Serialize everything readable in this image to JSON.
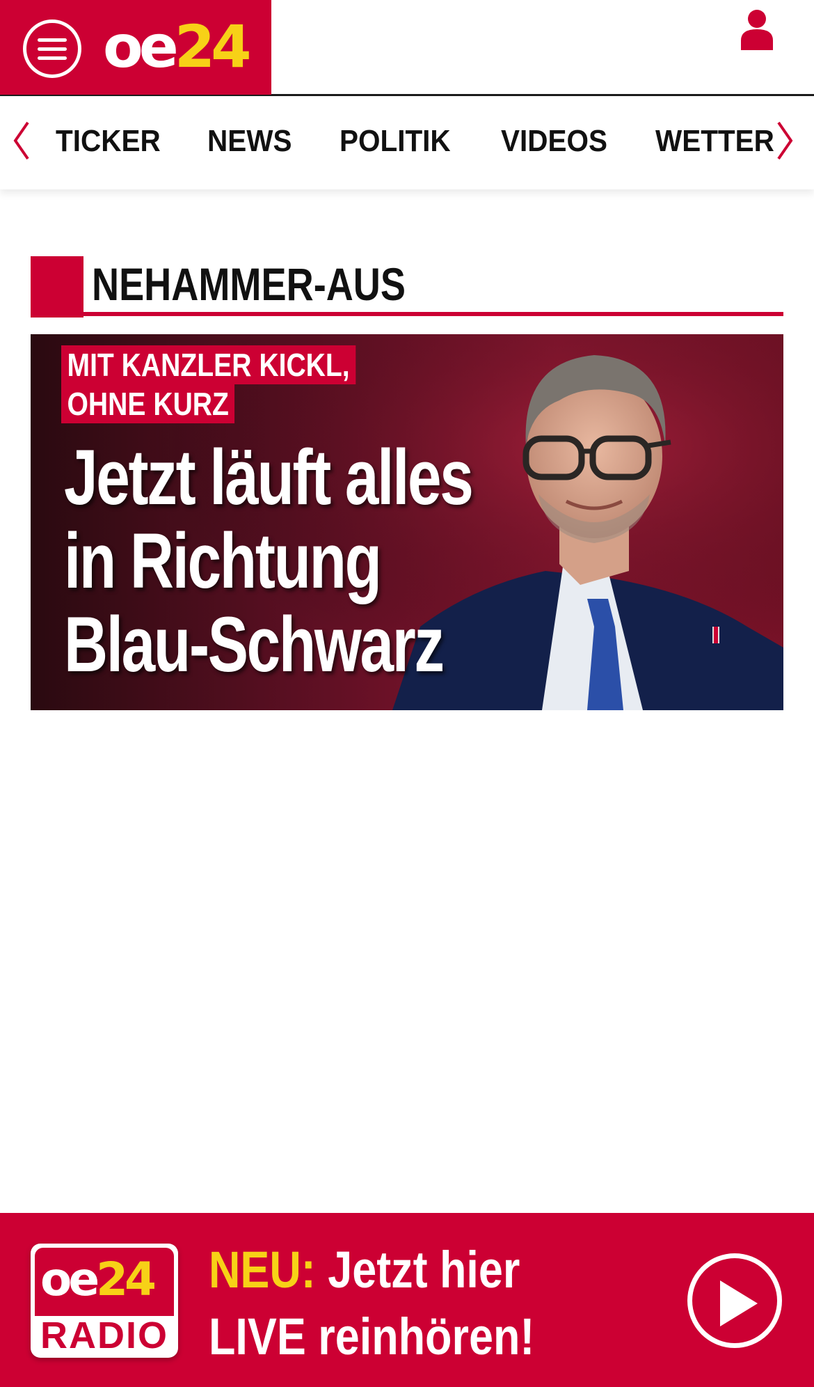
{
  "header": {
    "logo_oe": "oe",
    "logo_24": "24",
    "brand_color": "#cc0033",
    "accent_color": "#f7d117"
  },
  "nav": {
    "items": [
      {
        "label": "TICKER"
      },
      {
        "label": "NEWS"
      },
      {
        "label": "POLITIK"
      },
      {
        "label": "VIDEOS"
      },
      {
        "label": "WETTER"
      }
    ]
  },
  "section": {
    "title": "NEHAMMER-AUS"
  },
  "teaser": {
    "kicker_line1": "MIT KANZLER KICKL,",
    "kicker_line2": "OHNE KURZ",
    "headline_line1": "Jetzt läuft alles",
    "headline_line2": "in Richtung",
    "headline_line3": "Blau-Schwarz"
  },
  "radio": {
    "logo_oe": "oe",
    "logo_24": "24",
    "logo_label": "RADIO",
    "neu": "NEU:",
    "line1_rest": " Jetzt hier",
    "line2": "LIVE reinhören!"
  }
}
